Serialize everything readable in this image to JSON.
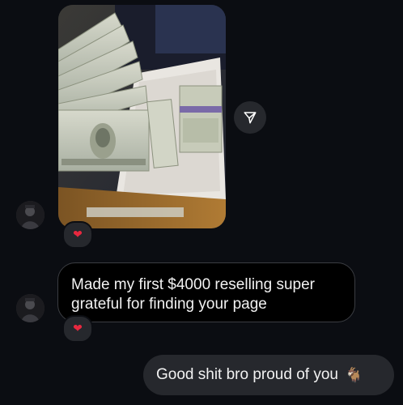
{
  "thread": {
    "messages": [
      {
        "type": "image",
        "direction": "incoming",
        "image_description": "stacks of US $100 bills on a table",
        "reaction": "❤"
      },
      {
        "type": "text",
        "direction": "incoming",
        "text": "Made my first $4000 reselling super grateful for finding your page",
        "reaction": "❤"
      },
      {
        "type": "text",
        "direction": "outgoing",
        "text": "Good shit bro proud of you",
        "emoji": "🐐"
      }
    ]
  },
  "icons": {
    "share": "paper-plane-icon",
    "reaction": "heart-icon"
  },
  "colors": {
    "background": "#0b0d12",
    "incoming_bubble": "#000000",
    "incoming_border": "#3b3d42",
    "outgoing_bubble": "#26282d",
    "heart": "#e8283f"
  }
}
